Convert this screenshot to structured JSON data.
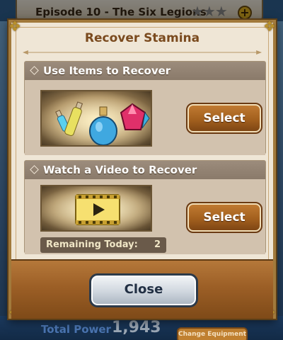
{
  "background": {
    "episode_title": "Episode 10 - The Six Legions",
    "stars": "★★★",
    "plus": "+",
    "total_label": "Total Power",
    "total_value": "1,943",
    "change_button": "Change Equipment"
  },
  "dialog": {
    "title": "Recover Stamina",
    "sections": [
      {
        "header": "Use Items to Recover",
        "button_label": "Select",
        "image": "items-icon"
      },
      {
        "header": "Watch a Video to Recover",
        "button_label": "Select",
        "image": "video-icon",
        "remaining_label": "Remaining Today:",
        "remaining_value": "2"
      }
    ],
    "close_label": "Close"
  },
  "colors": {
    "title": "#7a4a1e",
    "button_brown": "#a3601e",
    "dialog_bg": "#efe6d6",
    "footer": "#9c5f26"
  }
}
